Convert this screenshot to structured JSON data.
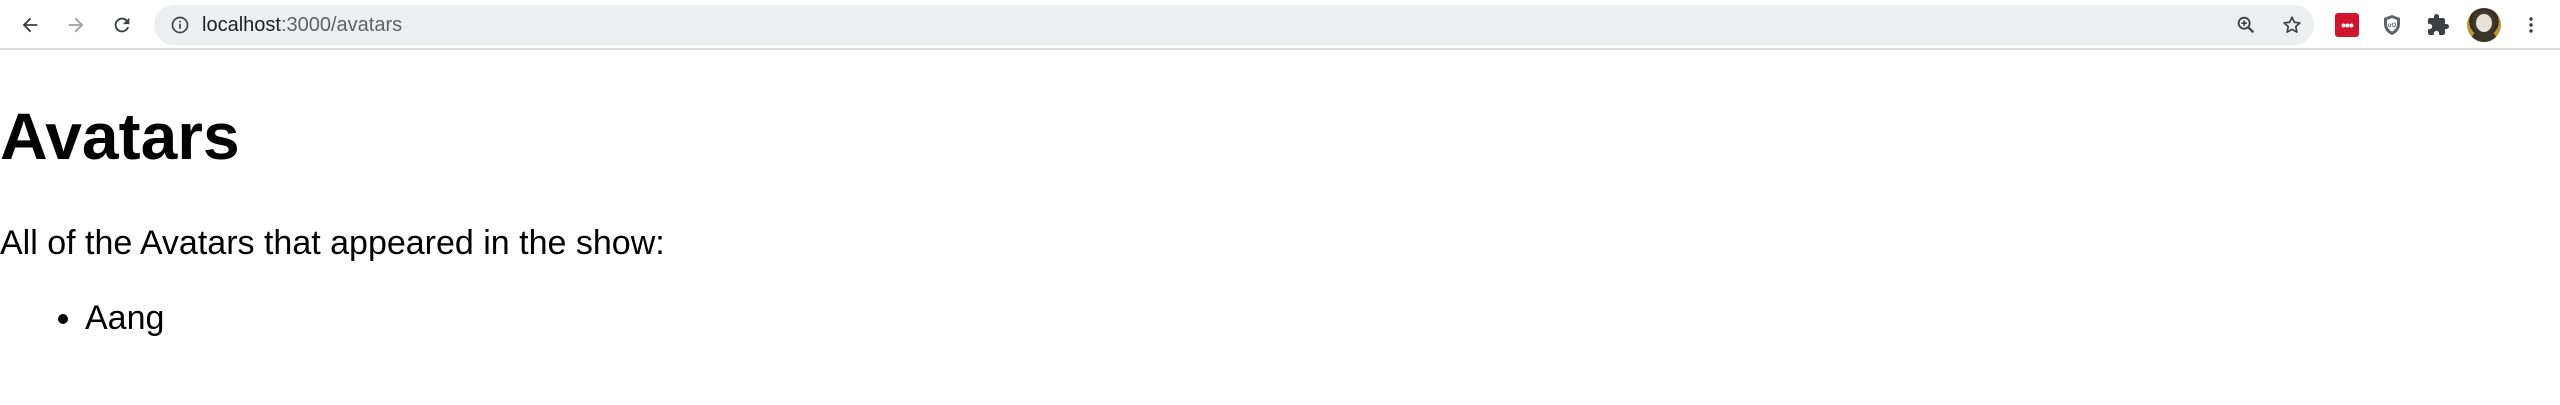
{
  "browser": {
    "url_host": "localhost",
    "url_path": ":3000/avatars",
    "icons": {
      "back": "back-arrow-icon",
      "forward": "forward-arrow-icon",
      "reload": "reload-icon",
      "info": "info-icon",
      "zoom": "zoom-icon",
      "bookmark": "star-icon",
      "ext1": "lastpass-extension-icon",
      "ext2": "shield-extension-icon",
      "ext3": "puzzle-icon",
      "profile": "avatar",
      "menu": "kebab-menu-icon"
    },
    "ext1_text": "•••",
    "accent_color": "#d3152b"
  },
  "page": {
    "title": "Avatars",
    "intro": "All of the Avatars that appeared in the show:",
    "avatars": [
      "Aang"
    ]
  }
}
